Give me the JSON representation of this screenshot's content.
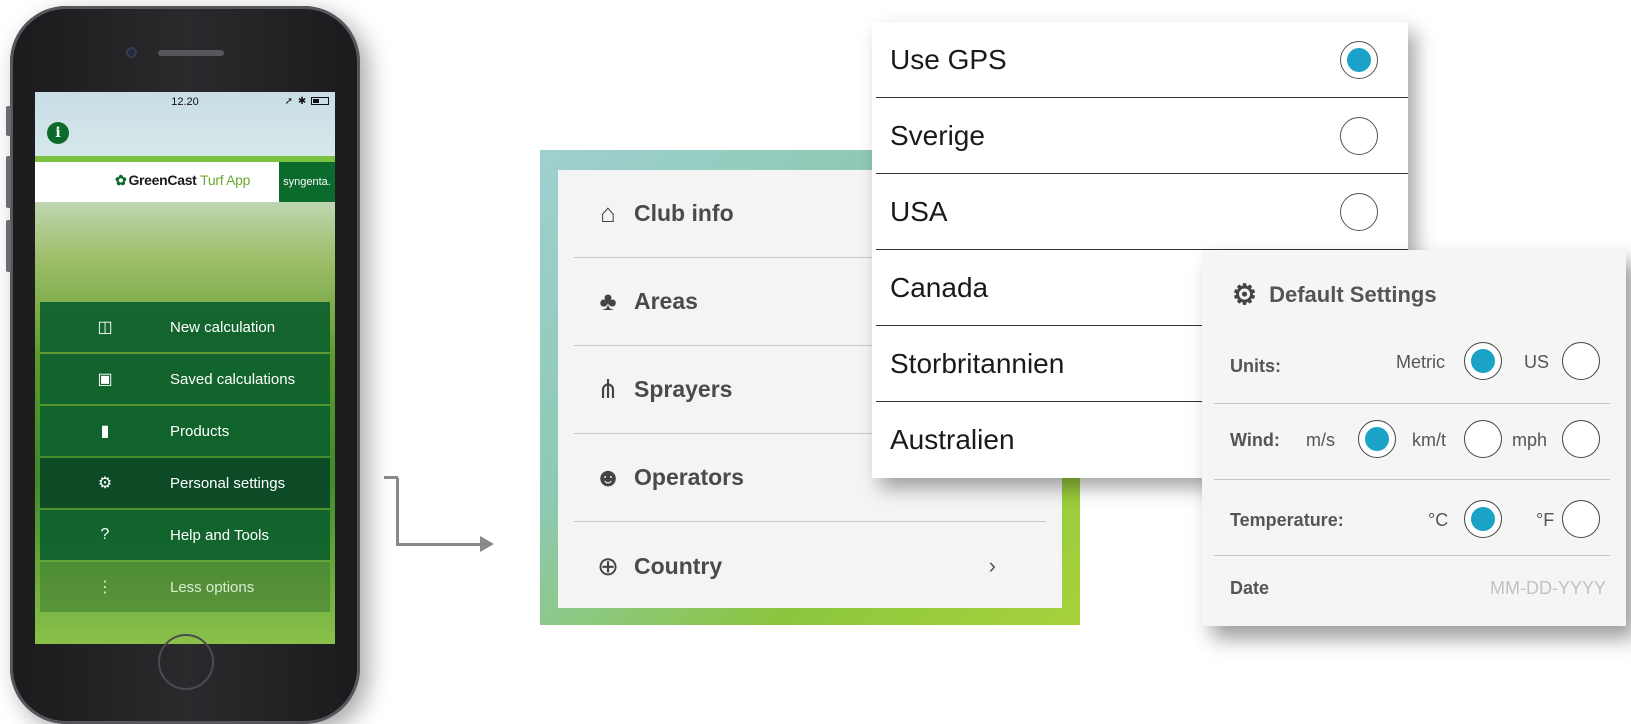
{
  "phone": {
    "status_time": "12.20",
    "status_icons": "➚ ✱",
    "info_icon": "i",
    "brand_name": "GreenCast",
    "brand_app": "Turf App",
    "partner": "syngenta.",
    "menu": [
      {
        "label": "New calculation",
        "icon": "calculator-icon",
        "glyph": "◫"
      },
      {
        "label": "Saved calculations",
        "icon": "briefcase-icon",
        "glyph": "▣"
      },
      {
        "label": "Products",
        "icon": "product-icon",
        "glyph": "▮"
      },
      {
        "label": "Personal settings",
        "icon": "gear-icon",
        "glyph": "⚙"
      },
      {
        "label": "Help and Tools",
        "icon": "question-icon",
        "glyph": "?"
      },
      {
        "label": "Less options",
        "icon": "more-vertical-icon",
        "glyph": "⋮"
      }
    ]
  },
  "settings_menu": {
    "items": [
      {
        "label": "Club info",
        "icon": "home-icon",
        "glyph": "⌂"
      },
      {
        "label": "Areas",
        "icon": "trees-icon",
        "glyph": "♣"
      },
      {
        "label": "Sprayers",
        "icon": "sprayer-icon",
        "glyph": "⋔"
      },
      {
        "label": "Operators",
        "icon": "users-icon",
        "glyph": "☻"
      },
      {
        "label": "Country",
        "icon": "globe-icon",
        "glyph": "⊕",
        "chevron": "›"
      }
    ]
  },
  "country_popup": {
    "options": [
      {
        "label": "Use GPS",
        "selected": true
      },
      {
        "label": "Sverige",
        "selected": false
      },
      {
        "label": "USA",
        "selected": false
      },
      {
        "label": "Canada",
        "selected": false
      },
      {
        "label": "Storbritannien",
        "selected": false
      },
      {
        "label": "Australien",
        "selected": false
      }
    ]
  },
  "default_settings": {
    "title": "Default Settings",
    "units": {
      "label": "Units:",
      "metric": "Metric",
      "us": "US",
      "selected": "Metric"
    },
    "wind": {
      "label": "Wind:",
      "ms": "m/s",
      "kmt": "km/t",
      "mph": "mph",
      "selected": "m/s"
    },
    "temperature": {
      "label": "Temperature:",
      "c": "°C",
      "f": "°F",
      "selected": "°C"
    },
    "date": {
      "label": "Date",
      "placeholder": "MM-DD-YYYY"
    }
  },
  "colors": {
    "accent": "#1aa2c7",
    "brand_green": "#0b6b2c",
    "lime": "#8bc63e"
  }
}
